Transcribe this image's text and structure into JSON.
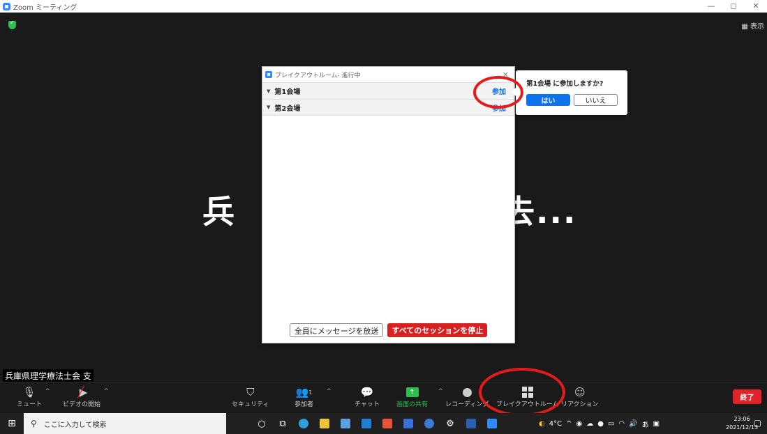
{
  "window": {
    "title": "Zoom ミーティング",
    "controls": [
      "—",
      "◻",
      "✕"
    ]
  },
  "stage": {
    "view_label": "▦ 表示",
    "big_name_left": "兵",
    "big_name_right": "去...",
    "name_label": "兵庫県理学療法士会 支"
  },
  "breakout_dialog": {
    "title": "ブレイクアウトルーム- 進行中",
    "close": "✕",
    "rooms": [
      {
        "name": "第1会場",
        "join_label": "参加"
      },
      {
        "name": "第2会場",
        "join_label": "参加"
      }
    ],
    "broadcast_button": "全員にメッセージを放送",
    "stop_button": "すべてのセッションを停止"
  },
  "join_popover": {
    "question": "第1会場 に参加しますか?",
    "yes": "はい",
    "no": "いいえ"
  },
  "toolbar": {
    "mute": "ミュート",
    "video": "ビデオの開始",
    "security": "セキュリティ",
    "participants": "参加者",
    "participants_count": "1",
    "chat": "チャット",
    "share": "画面の共有",
    "record": "レコーディング",
    "breakout": "ブレイクアウトルーム",
    "reaction": "リアクション",
    "end": "終了"
  },
  "taskbar": {
    "search_placeholder": "ここに入力して検索",
    "temperature": "4°C",
    "ime": "あ",
    "time": "23:06",
    "date": "2021/12/13"
  },
  "colors": {
    "accent_blue": "#0e72ed",
    "stop_red": "#d92020",
    "share_green": "#2fbe4e",
    "annotation_red": "#e21b1b"
  }
}
